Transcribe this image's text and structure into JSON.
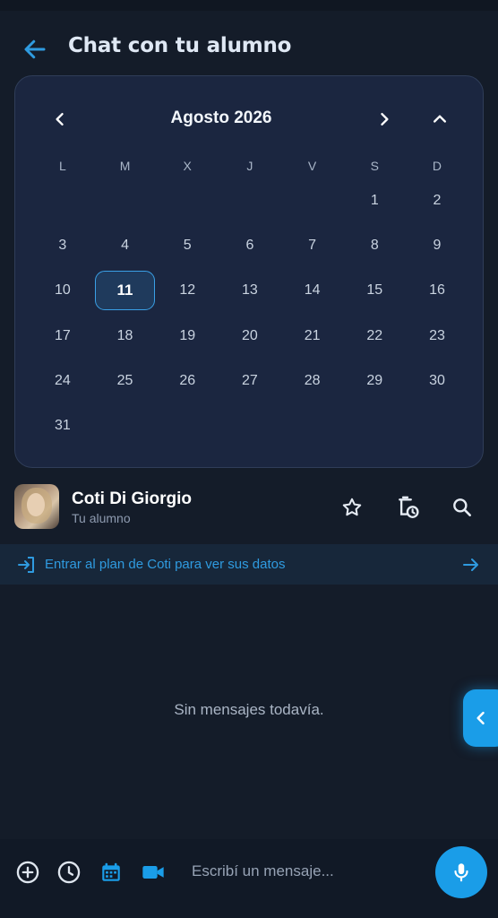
{
  "header": {
    "title": "Chat con tu alumno"
  },
  "calendar": {
    "month_label": "Agosto 2026",
    "weekdays": [
      "L",
      "M",
      "X",
      "J",
      "V",
      "S",
      "D"
    ],
    "weeks": [
      [
        "",
        "",
        "",
        "",
        "",
        "1",
        "2"
      ],
      [
        "3",
        "4",
        "5",
        "6",
        "7",
        "8",
        "9"
      ],
      [
        "10",
        "11",
        "12",
        "13",
        "14",
        "15",
        "16"
      ],
      [
        "17",
        "18",
        "19",
        "20",
        "21",
        "22",
        "23"
      ],
      [
        "24",
        "25",
        "26",
        "27",
        "28",
        "29",
        "30"
      ],
      [
        "31",
        "",
        "",
        "",
        "",
        "",
        ""
      ]
    ],
    "selected_day": "11"
  },
  "contact": {
    "name": "Coti Di Giorgio",
    "subtitle": "Tu alumno"
  },
  "plan_banner": {
    "text": "Entrar al plan de Coti para ver sus datos"
  },
  "chat": {
    "empty_text": "Sin mensajes todavía."
  },
  "composer": {
    "placeholder": "Escribí un mensaje..."
  },
  "colors": {
    "accent": "#1a9de8",
    "background": "#141c29",
    "panel": "#1b2640",
    "link": "#2f9be0"
  }
}
